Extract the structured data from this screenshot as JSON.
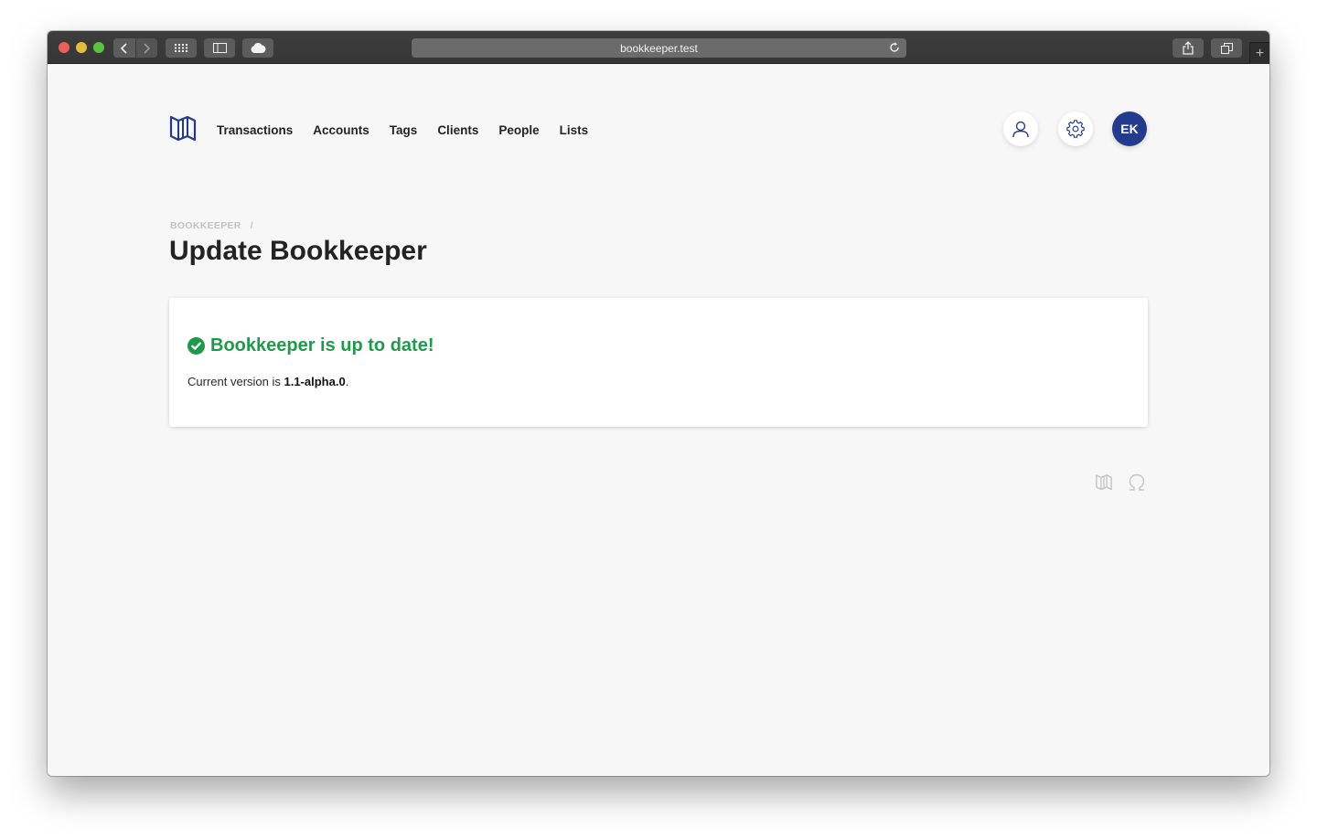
{
  "browser": {
    "url": "bookkeeper.test",
    "icons": {
      "back": "chevron-left-icon",
      "forward": "chevron-right-icon",
      "grid": "grid-icon",
      "sidebar": "sidebar-icon",
      "cloud": "cloud-icon",
      "reload": "reload-icon",
      "share": "share-icon",
      "tabs": "tabs-icon",
      "new_tab": "+"
    }
  },
  "nav": {
    "logo": "map-icon",
    "links": [
      {
        "label": "Transactions"
      },
      {
        "label": "Accounts"
      },
      {
        "label": "Tags"
      },
      {
        "label": "Clients"
      },
      {
        "label": "People"
      },
      {
        "label": "Lists"
      }
    ],
    "avatar_initials": "EK",
    "accent_color": "#243a8c"
  },
  "breadcrumb": {
    "items": [
      "BOOKKEEPER"
    ],
    "separator": "/"
  },
  "page": {
    "title": "Update Bookkeeper"
  },
  "status": {
    "heading": "Bookkeeper is up to date!",
    "version_prefix": "Current version is ",
    "version": "1.1-alpha.0",
    "version_suffix": ".",
    "color": "#1f9a4b"
  },
  "footer": {
    "icons": [
      "map-icon",
      "omega-icon"
    ]
  }
}
